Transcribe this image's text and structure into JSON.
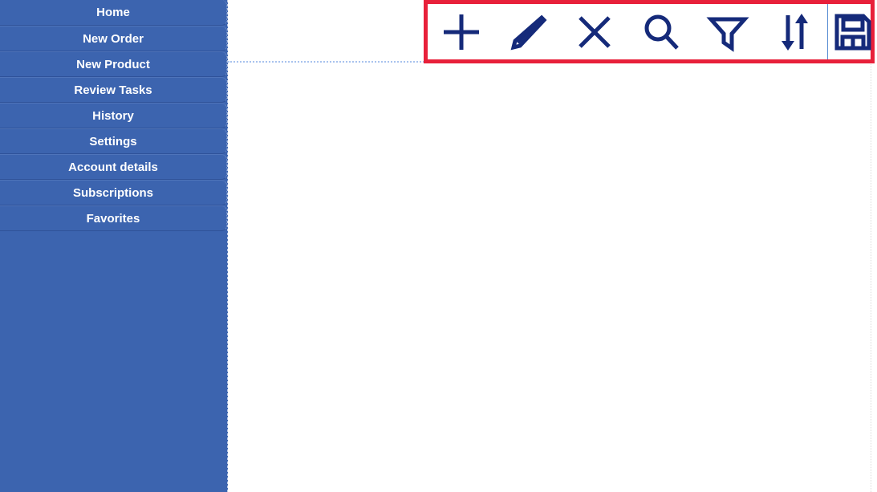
{
  "app": {
    "background_color": "#ffffff",
    "sidebar_color": "#3c64af",
    "accent_color": "#152a7a",
    "highlight_color": "#e8203a",
    "sidebar_text_color": "#ffffff"
  },
  "sidebar": {
    "items": [
      {
        "label": "Home",
        "name": "sidebar-item-home"
      },
      {
        "label": "New Order",
        "name": "sidebar-item-new-order"
      },
      {
        "label": "New Product",
        "name": "sidebar-item-new-product"
      },
      {
        "label": "Review Tasks",
        "name": "sidebar-item-review-tasks"
      },
      {
        "label": "History",
        "name": "sidebar-item-history"
      },
      {
        "label": "Settings",
        "name": "sidebar-item-settings"
      },
      {
        "label": "Account details",
        "name": "sidebar-item-account-details"
      },
      {
        "label": "Subscriptions",
        "name": "sidebar-item-subscriptions"
      },
      {
        "label": "Favorites",
        "name": "sidebar-item-favorites"
      }
    ]
  },
  "toolbar": {
    "highlighted": true,
    "buttons": [
      {
        "icon": "plus-icon",
        "label": "Add"
      },
      {
        "icon": "pencil-icon",
        "label": "Edit"
      },
      {
        "icon": "close-x-icon",
        "label": "Delete"
      },
      {
        "icon": "search-icon",
        "label": "Search"
      },
      {
        "icon": "filter-funnel-icon",
        "label": "Filter"
      },
      {
        "icon": "sort-arrows-icon",
        "label": "Sort"
      },
      {
        "icon": "save-floppy-icon",
        "label": "Save"
      }
    ]
  },
  "main": {
    "content_text": ""
  }
}
